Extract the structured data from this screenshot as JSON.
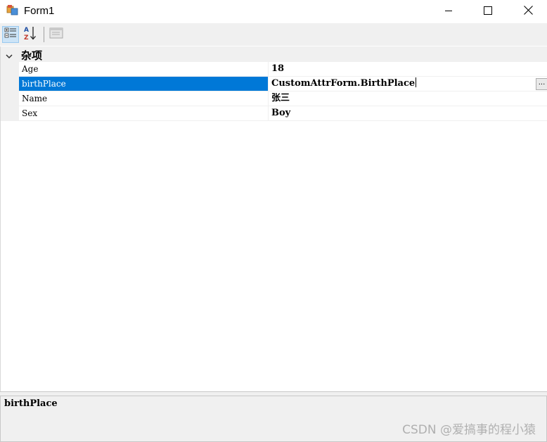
{
  "window": {
    "title": "Form1",
    "icons": {
      "app": "form-app-icon",
      "minimize": "minimize-icon",
      "maximize": "maximize-icon",
      "close": "close-icon"
    }
  },
  "toolbar": {
    "buttons": [
      {
        "icon": "categorized-view-icon",
        "active": true
      },
      {
        "icon": "alphabetical-sort-icon",
        "active": false
      },
      {
        "icon": "property-pages-icon",
        "active": false
      }
    ]
  },
  "grid": {
    "category": {
      "label": "杂项",
      "expanded": true
    },
    "properties": [
      {
        "name": "Age",
        "value": "18",
        "selected": false
      },
      {
        "name": "birthPlace",
        "value": "CustomAttrForm.BirthPlace",
        "selected": true,
        "has_ellipsis": true
      },
      {
        "name": "Name",
        "value": "张三",
        "selected": false
      },
      {
        "name": "Sex",
        "value": "Boy",
        "selected": false
      }
    ],
    "ellipsis_label": "..."
  },
  "help": {
    "title": "birthPlace"
  },
  "watermark": "CSDN @爱搞事的程小猿",
  "colors": {
    "selection": "#0078d7",
    "toolbar_bg": "#f0f0f0",
    "active_button": "#cce4f7"
  }
}
